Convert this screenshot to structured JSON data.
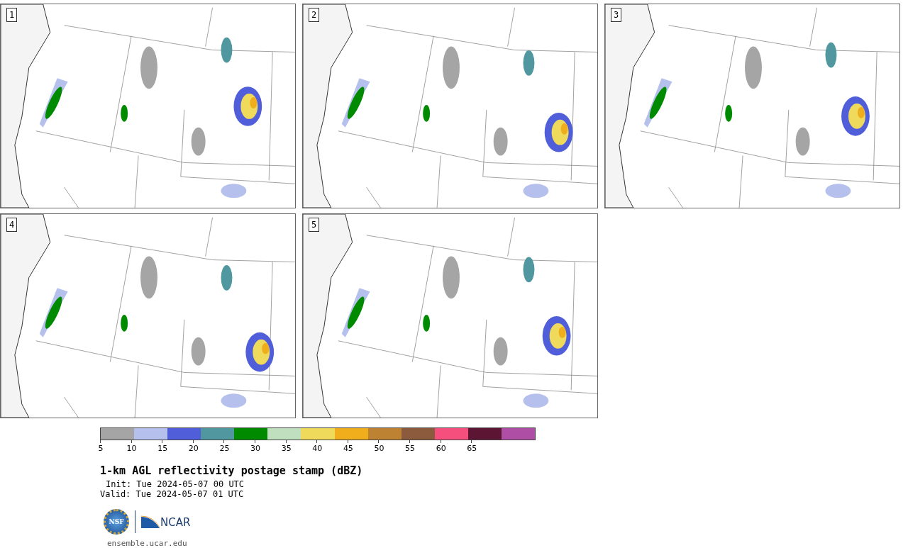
{
  "panels": [
    {
      "number": "1"
    },
    {
      "number": "2"
    },
    {
      "number": "3"
    },
    {
      "number": "4"
    },
    {
      "number": "5"
    }
  ],
  "colorbar": {
    "segments": [
      {
        "color": "#a5a5a5"
      },
      {
        "color": "#b6c0ec"
      },
      {
        "color": "#505fd9"
      },
      {
        "color": "#50979f"
      },
      {
        "color": "#008a00"
      },
      {
        "color": "#bfdfbf"
      },
      {
        "color": "#f0da5c"
      },
      {
        "color": "#f0ad1c"
      },
      {
        "color": "#bd8232"
      },
      {
        "color": "#8c5a3c"
      },
      {
        "color": "#f5507d"
      },
      {
        "color": "#5c1533"
      },
      {
        "color": "#ae4fa5"
      }
    ],
    "ticks": [
      "5",
      "10",
      "15",
      "20",
      "25",
      "30",
      "35",
      "40",
      "45",
      "50",
      "55",
      "60",
      "65"
    ]
  },
  "title": "1-km AGL reflectivity postage stamp (dBZ)",
  "init": "Init: Tue 2024-05-07 00 UTC",
  "valid": "Valid: Tue 2024-05-07 01 UTC",
  "logos": {
    "nsf": "NSF",
    "ncar": "NCAR"
  },
  "url": "ensemble.ucar.edu"
}
